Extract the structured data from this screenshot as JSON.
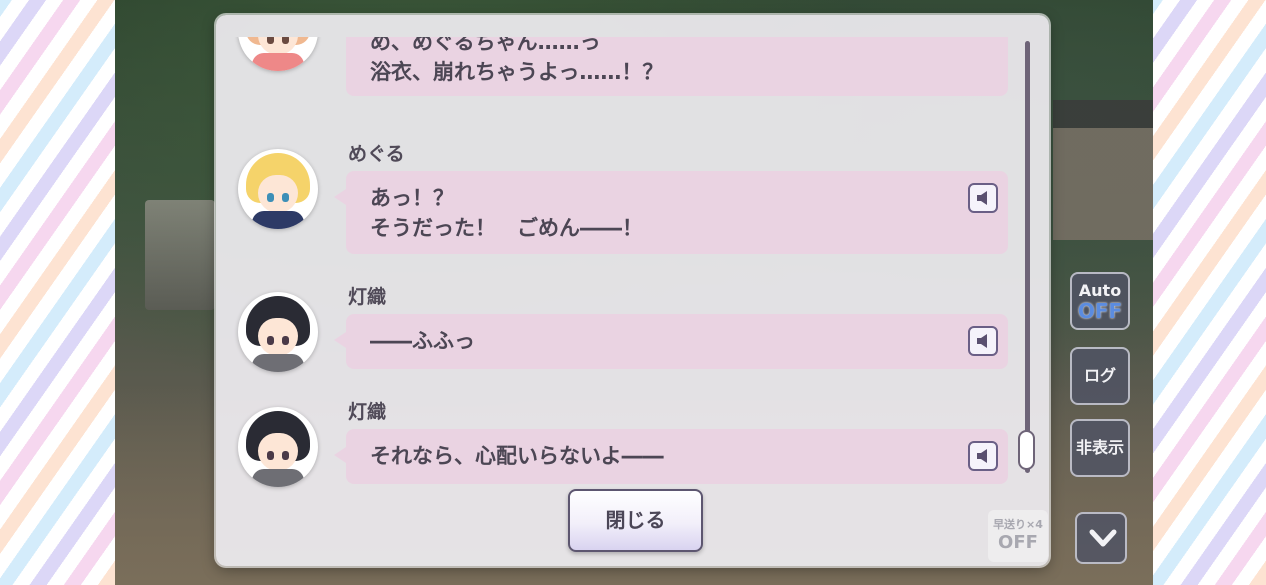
{
  "log": {
    "entries": [
      {
        "speaker": "",
        "lines": [
          "め、めぐるちゃん……っ",
          "浴衣、崩れちゃうよっ……！？"
        ],
        "avatar": "peach"
      },
      {
        "speaker": "めぐる",
        "lines": [
          "あっ！？",
          "そうだった！　ごめん――！"
        ],
        "avatar": "blonde"
      },
      {
        "speaker": "灯織",
        "lines": [
          "――ふふっ"
        ],
        "avatar": "dark"
      },
      {
        "speaker": "灯織",
        "lines": [
          "それなら、心配いらないよ――"
        ],
        "avatar": "dark"
      }
    ],
    "close_label": "閉じる"
  },
  "controls": {
    "auto_label": "Auto",
    "auto_state": "OFF",
    "log_label": "ログ",
    "hide_label": "非表示",
    "speed_label": "早送り×4",
    "speed_state": "OFF"
  },
  "colors": {
    "bubble": "#ead3e2",
    "panel": "#eeecf0",
    "text": "#4c4654",
    "accent": "#5b8ce0"
  }
}
